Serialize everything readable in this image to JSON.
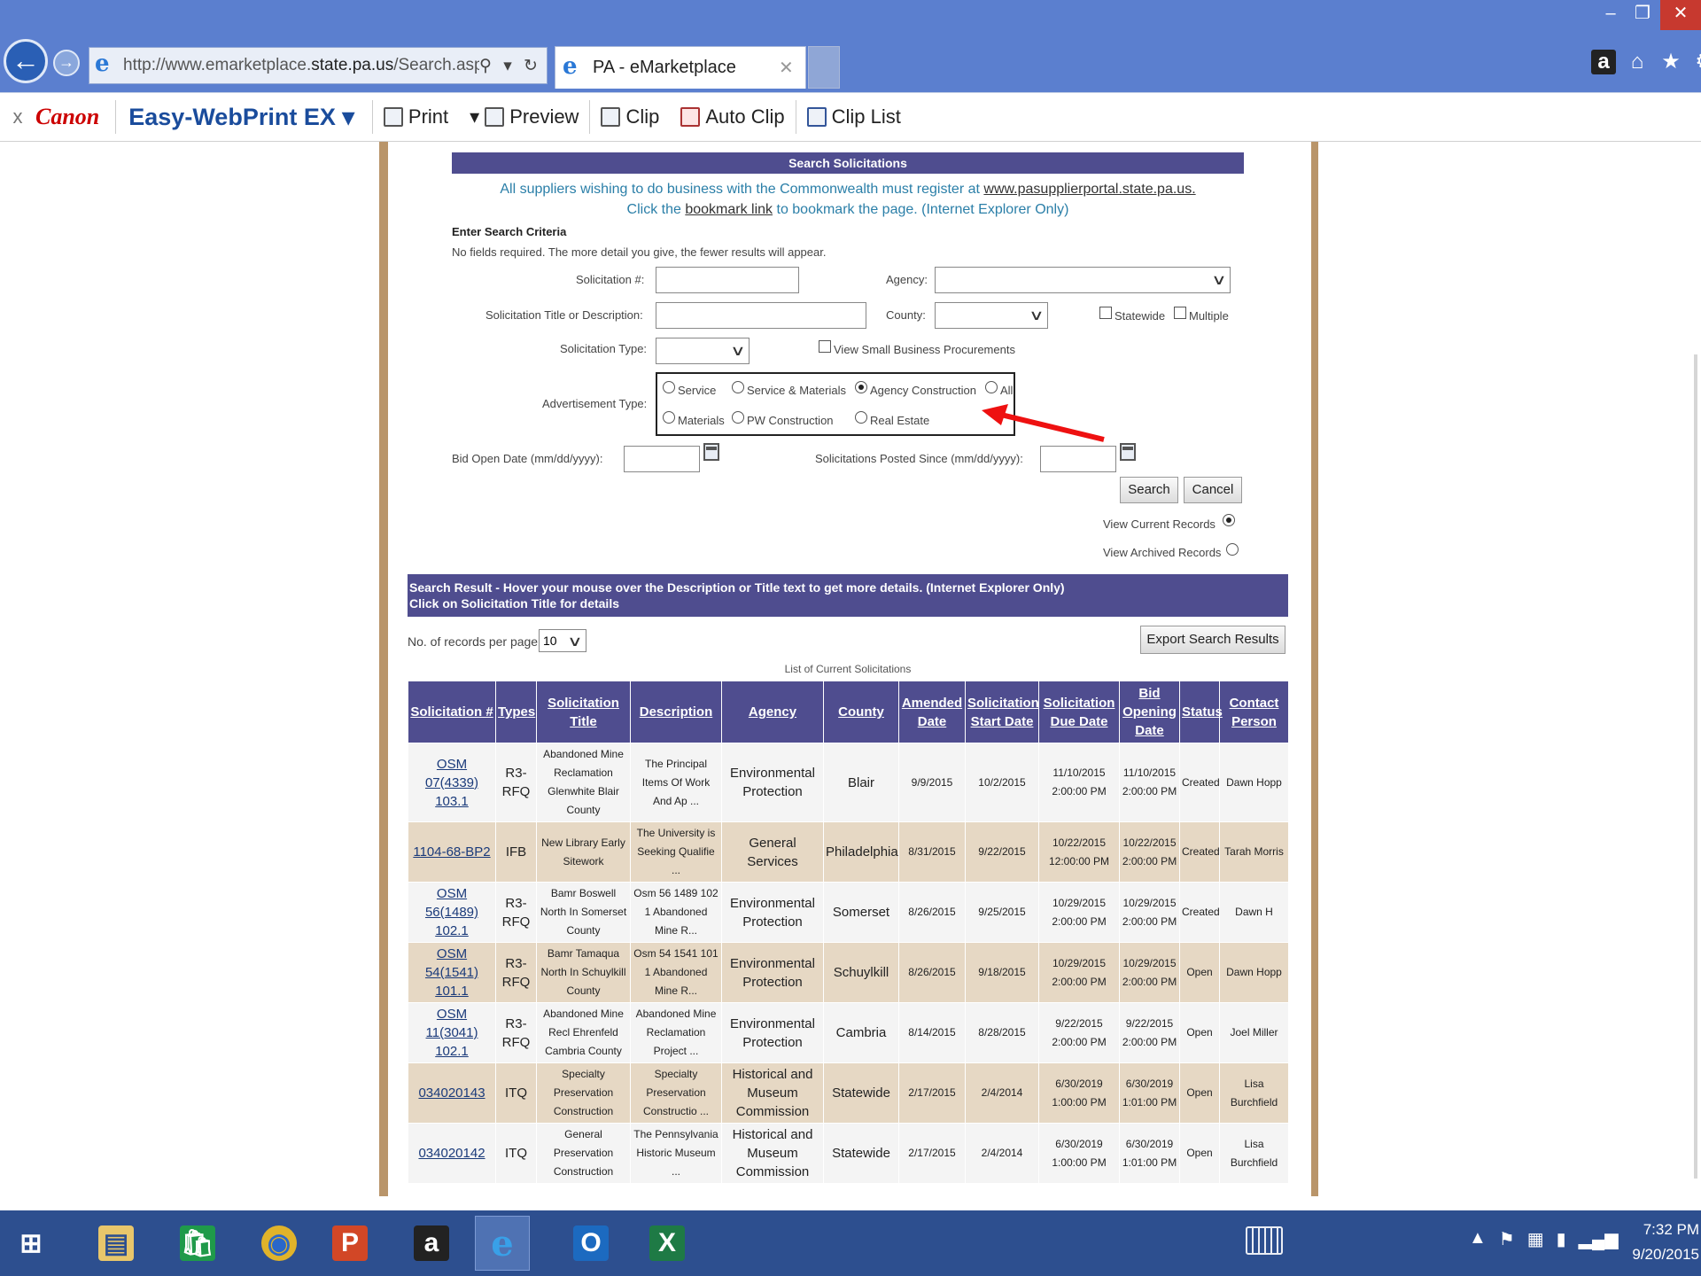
{
  "browser": {
    "window_controls": {
      "minimize": "–",
      "maximize": "❐",
      "close": "✕"
    },
    "nav": {
      "back": "←",
      "forward": "→"
    },
    "address": {
      "url_prefix": "http://www.emarketplace.",
      "url_domain": "state.pa.us",
      "url_path": "/Search.aspx",
      "tools": "⚲ ▾ ↻"
    },
    "tab": {
      "title": "PA - eMarketplace",
      "close": "✕"
    },
    "right_icons": {
      "amazon": "a",
      "home": "⌂",
      "favorites": "★",
      "settings": "⚙"
    },
    "toolbar": {
      "close": "x",
      "canon": "Canon",
      "easy_webprint": "Easy-WebPrint EX ▾",
      "print": "Print",
      "preview_dropdown": "▾",
      "preview": "Preview",
      "clip": "Clip",
      "auto_clip": "Auto Clip",
      "clip_list": "Clip List"
    }
  },
  "search": {
    "header": "Search Solicitations",
    "notice_line1_pre": "All suppliers wishing to do business with the Commonwealth must register at ",
    "notice_link": "www.pasupplierportal.state.pa.us.",
    "notice_line2_pre": "Click the ",
    "bookmark_link": "bookmark link",
    "notice_line2_post": " to bookmark the page. (Internet Explorer Only)",
    "criteria_title": "Enter Search Criteria",
    "criteria_hint": "No fields required. The more detail you give, the fewer results will appear.",
    "solicitation_no_label": "Solicitation #:",
    "agency_label": "Agency:",
    "title_desc_label": "Solicitation Title or Description:",
    "county_label": "County:",
    "statewide_label": "Statewide",
    "multiple_label": "Multiple",
    "type_label": "Solicitation Type:",
    "small_business_label": "View Small Business Procurements",
    "adv_type_label": "Advertisement Type:",
    "adv_options": {
      "service": "Service",
      "service_materials": "Service & Materials",
      "agency_construction": "Agency Construction",
      "all": "All",
      "materials": "Materials",
      "pw_construction": "PW Construction",
      "real_estate": "Real Estate"
    },
    "selected_adv": "agency_construction",
    "bid_open_label": "Bid Open Date (mm/dd/yyyy):",
    "posted_since_label": "Solicitations Posted Since (mm/dd/yyyy):",
    "search_button": "Search",
    "cancel_button": "Cancel",
    "view_current": "View Current Records",
    "view_archived": "View Archived Records"
  },
  "results": {
    "header_line1": "Search Result - Hover your mouse over the Description or Title text to get more details. (Internet Explorer Only)",
    "header_line2": "Click on Solicitation Title for details",
    "per_page_label": "No. of records per page:",
    "per_page_value": "10",
    "export_button": "Export Search Results",
    "caption": "List of Current Solicitations",
    "columns": [
      "Solicitation #",
      "Types",
      "Solicitation Title",
      "Description",
      "Agency",
      "County",
      "Amended Date",
      "Solicitation Start Date",
      "Solicitation Due Date",
      "Bid Opening Date",
      "Status",
      "Contact Person"
    ],
    "rows": [
      [
        "OSM 07(4339) 103.1",
        "R3-RFQ",
        "Abandoned Mine Reclamation Glenwhite Blair County",
        "The Principal Items Of Work And Ap ...",
        "Environmental Protection",
        "Blair",
        "9/9/2015",
        "10/2/2015",
        "11/10/2015 2:00:00 PM",
        "11/10/2015 2:00:00 PM",
        "Created",
        "Dawn Hopp"
      ],
      [
        "1104-68-BP2",
        "IFB",
        "New Library Early Sitework",
        "The University is Seeking Qualifie ...",
        "General Services",
        "Philadelphia",
        "8/31/2015",
        "9/22/2015",
        "10/22/2015 12:00:00 PM",
        "10/22/2015 2:00:00 PM",
        "Created",
        "Tarah Morris"
      ],
      [
        "OSM 56(1489) 102.1",
        "R3-RFQ",
        "Bamr Boswell North In Somerset County",
        "Osm 56 1489 102 1 Abandoned Mine R...",
        "Environmental Protection",
        "Somerset",
        "8/26/2015",
        "9/25/2015",
        "10/29/2015 2:00:00 PM",
        "10/29/2015 2:00:00 PM",
        "Created",
        "Dawn H"
      ],
      [
        "OSM 54(1541) 101.1",
        "R3-RFQ",
        "Bamr Tamaqua North In Schuylkill County",
        "Osm 54 1541 101 1 Abandoned Mine R...",
        "Environmental Protection",
        "Schuylkill",
        "8/26/2015",
        "9/18/2015",
        "10/29/2015 2:00:00 PM",
        "10/29/2015 2:00:00 PM",
        "Open",
        "Dawn Hopp"
      ],
      [
        "OSM 11(3041) 102.1",
        "R3-RFQ",
        "Abandoned Mine Recl Ehrenfeld Cambria County",
        "Abandoned Mine Reclamation Project ...",
        "Environmental Protection",
        "Cambria",
        "8/14/2015",
        "8/28/2015",
        "9/22/2015 2:00:00 PM",
        "9/22/2015 2:00:00 PM",
        "Open",
        "Joel Miller"
      ],
      [
        "034020143",
        "ITQ",
        "Specialty Preservation Construction",
        "Specialty Preservation Constructio ...",
        "Historical and Museum Commission",
        "Statewide",
        "2/17/2015",
        "2/4/2014",
        "6/30/2019 1:00:00 PM",
        "6/30/2019 1:01:00 PM",
        "Open",
        "Lisa Burchfield"
      ],
      [
        "034020142",
        "ITQ",
        "General Preservation Construction",
        "The Pennsylvania Historic Museum ...",
        "Historical and Museum Commission",
        "Statewide",
        "2/17/2015",
        "2/4/2014",
        "6/30/2019 1:00:00 PM",
        "6/30/2019 1:01:00 PM",
        "Open",
        "Lisa Burchfield"
      ]
    ]
  },
  "taskbar": {
    "apps": [
      {
        "name": "windows-start-icon",
        "glyph": "⊞"
      },
      {
        "name": "file-explorer-icon",
        "glyph": "▤"
      },
      {
        "name": "store-icon",
        "glyph": "🛍"
      },
      {
        "name": "chrome-icon",
        "glyph": "◉"
      },
      {
        "name": "powerpoint-icon",
        "glyph": "P"
      },
      {
        "name": "amazon-icon",
        "glyph": "a"
      },
      {
        "name": "internet-explorer-icon",
        "glyph": "e"
      },
      {
        "name": "outlook-icon",
        "glyph": "O"
      },
      {
        "name": "excel-icon",
        "glyph": "X"
      }
    ],
    "tray": {
      "expand": "▲",
      "flag": "⚑",
      "network": "▦",
      "battery": "▮",
      "signal": "▂▄▆"
    },
    "time": "7:32 PM",
    "date": "9/20/2015"
  },
  "colors": {
    "chrome_blue": "#5b7fcf",
    "header_purple": "#4f4d8f",
    "frame_tan": "#b9956a",
    "row_tan": "#e6d8c4",
    "notice_blue": "#2b7fa8",
    "annotation_red": "#ee1111"
  }
}
